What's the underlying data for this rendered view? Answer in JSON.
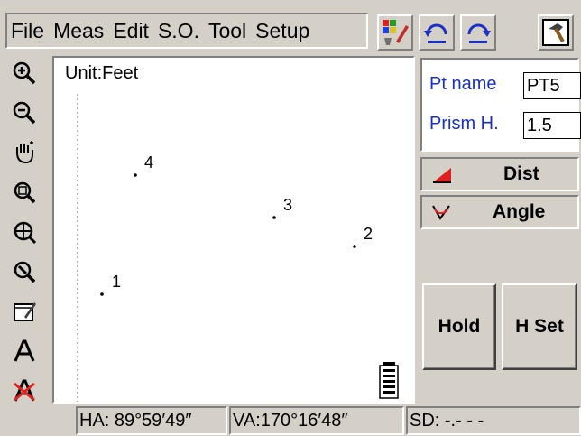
{
  "menu": {
    "items": [
      "File",
      "Meas",
      "Edit",
      "S.O.",
      "Tool",
      "Setup"
    ]
  },
  "map": {
    "unit_label": "Unit:Feet",
    "points": [
      {
        "label": "1"
      },
      {
        "label": "2"
      },
      {
        "label": "3"
      },
      {
        "label": "4"
      }
    ]
  },
  "point_fields": {
    "pt_name_label": "Pt name",
    "pt_name_value": "PT5",
    "prism_label": "Prism H.",
    "prism_value": "1.5"
  },
  "modes": {
    "dist_label": "Dist",
    "angle_label": "Angle"
  },
  "buttons": {
    "hold_label": "Hold",
    "hset_label": "H Set"
  },
  "status": {
    "ha": "HA: 89°59′49″",
    "va": "VA:170°16′48″",
    "sd": "SD:    -.- - -"
  },
  "icons": {
    "toolbar": [
      "color-palette-icon",
      "undo-icon",
      "redo-icon",
      "hammer-icon"
    ],
    "left": [
      "zoom-in-icon",
      "zoom-out-icon",
      "pan-hand-icon",
      "zoom-window-icon",
      "zoom-center-icon",
      "zoom-extents-icon",
      "note-edit-icon",
      "text-icon",
      "delete-text-icon"
    ]
  }
}
